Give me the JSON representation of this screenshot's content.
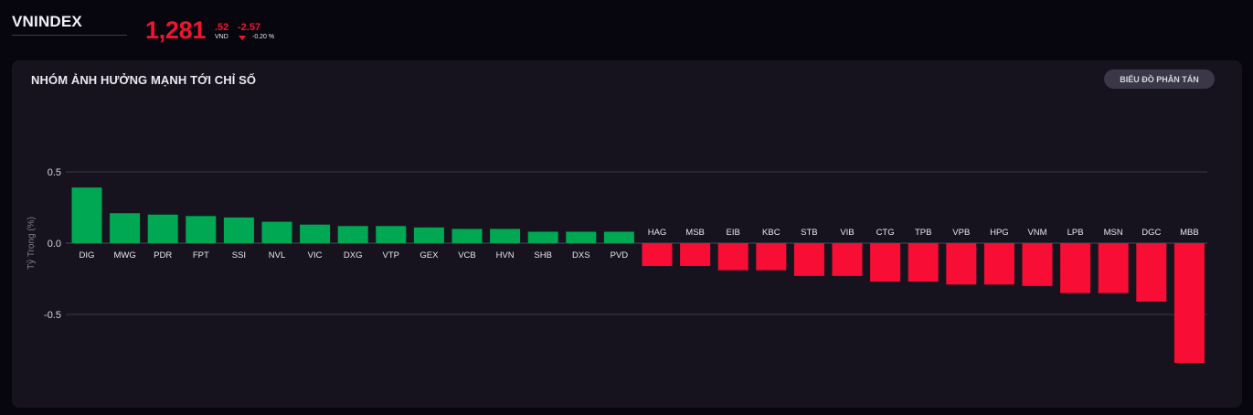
{
  "header": {
    "index_name": "VNINDEX",
    "price_main": "1,281",
    "price_decimal": ".52",
    "currency": "VND",
    "change_abs": "-2.57",
    "change_pct": "-0.20 %"
  },
  "panel": {
    "title": "NHÓM ẢNH HƯỞNG MẠNH TỚI CHỈ SỐ",
    "scatter_button": "BIỂU ĐỒ PHÂN TÁN"
  },
  "colors": {
    "positive": "#00a854",
    "negative": "#f80d35",
    "background": "#07060f",
    "panel": "#16131f"
  },
  "chart_data": {
    "type": "bar",
    "ylabel": "Tỷ Trọng (%)",
    "ylim": [
      -0.85,
      0.5
    ],
    "yticks": [
      0.5,
      0.0,
      -0.5
    ],
    "ytick_labels": [
      "0.5",
      "0.0",
      "-0.5"
    ],
    "grid": true,
    "categories": [
      "DIG",
      "MWG",
      "PDR",
      "FPT",
      "SSI",
      "NVL",
      "VIC",
      "DXG",
      "VTP",
      "GEX",
      "VCB",
      "HVN",
      "SHB",
      "DXS",
      "PVD",
      "HAG",
      "MSB",
      "EIB",
      "KBC",
      "STB",
      "VIB",
      "CTG",
      "TPB",
      "VPB",
      "HPG",
      "VNM",
      "LPB",
      "MSN",
      "DGC",
      "MBB"
    ],
    "values": [
      0.39,
      0.21,
      0.2,
      0.19,
      0.18,
      0.15,
      0.13,
      0.12,
      0.12,
      0.11,
      0.1,
      0.1,
      0.08,
      0.08,
      0.08,
      -0.16,
      -0.16,
      -0.19,
      -0.19,
      -0.23,
      -0.23,
      -0.27,
      -0.27,
      -0.29,
      -0.29,
      -0.3,
      -0.35,
      -0.35,
      -0.41,
      -0.84
    ]
  }
}
